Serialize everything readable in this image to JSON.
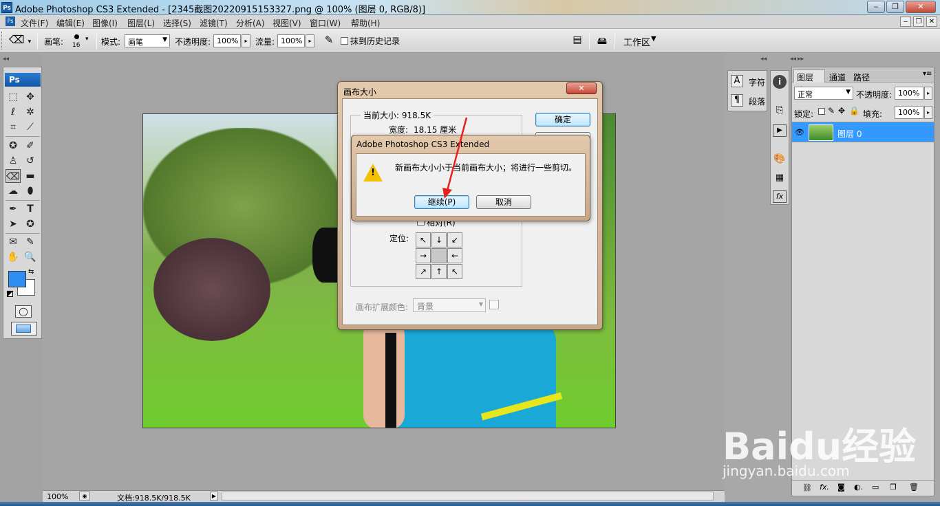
{
  "window": {
    "app_icon": "Ps",
    "title": "Adobe Photoshop CS3 Extended - [2345截图20220915153327.png @ 100% (图层 0, RGB/8)]",
    "minimize": "‒",
    "restore": "❐",
    "close": "✕"
  },
  "menu": {
    "doc_icon": "Ps",
    "items": [
      "文件(F)",
      "编辑(E)",
      "图像(I)",
      "图层(L)",
      "选择(S)",
      "滤镜(T)",
      "分析(A)",
      "视图(V)",
      "窗口(W)",
      "帮助(H)"
    ],
    "doc_min": "‒",
    "doc_restore": "❐",
    "doc_close": "✕"
  },
  "options": {
    "brush_label": "画笔:",
    "brush_size": "16",
    "mode_label": "模式:",
    "mode_value": "画笔",
    "opacity_label": "不透明度:",
    "opacity_value": "100%",
    "flow_label": "流量:",
    "flow_value": "100%",
    "erase_history_label": "抹到历史记录",
    "workspace_label": "工作区"
  },
  "toolbox": {
    "logo": "Ps",
    "foreground_color": "#2f8ff0",
    "background_color": "#ffffff"
  },
  "status": {
    "zoom": "100%",
    "doc_info": "文档:918.5K/918.5K"
  },
  "canvas_dialog": {
    "title": "画布大小",
    "current_size_label": "当前大小: 918.5K",
    "width_label": "宽度:",
    "width_value": "18.15 厘米",
    "ok_label": "确定",
    "relative_label": "相对(R)",
    "anchor_label": "定位:",
    "extension_color_label": "画布扩展颜色:",
    "extension_color_value": "背景"
  },
  "alert_dialog": {
    "title": "Adobe Photoshop CS3 Extended",
    "message": "新画布大小小于当前画布大小；将进行一些剪切。",
    "continue_label": "继续(P)",
    "cancel_label": "取消"
  },
  "char_panel": {
    "char_label": "字符",
    "para_label": "段落"
  },
  "layers_panel": {
    "tabs": [
      "图层",
      "通道",
      "路径"
    ],
    "blend_mode": "正常",
    "opacity_label": "不透明度:",
    "opacity_value": "100%",
    "lock_label": "锁定:",
    "fill_label": "填充:",
    "fill_value": "100%",
    "layer_name": "图层 0"
  },
  "watermark": {
    "brand": "Baidu经验",
    "url": "jingyan.baidu.com"
  },
  "colors": {
    "selection_blue": "#3399ff",
    "accent_red": "#e8201c"
  }
}
